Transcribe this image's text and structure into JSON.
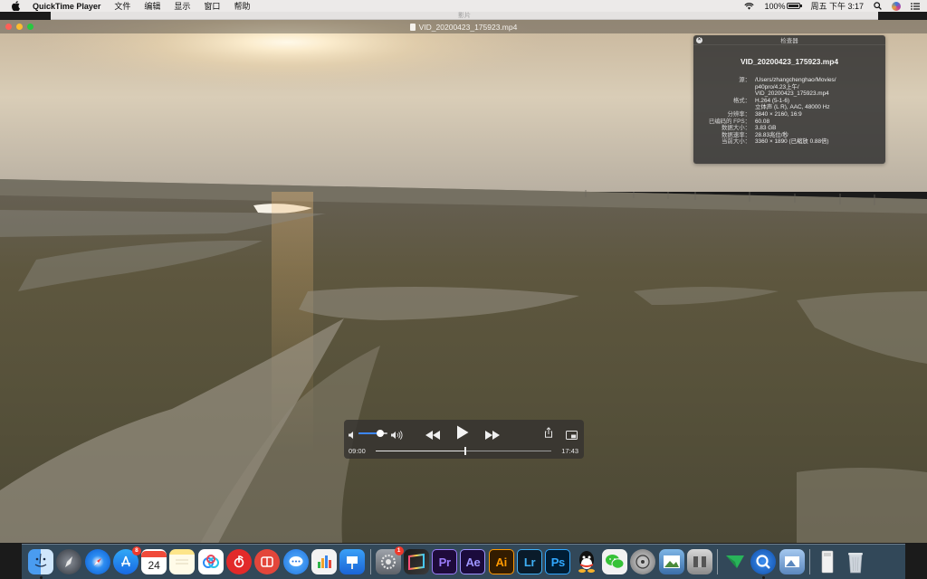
{
  "menubar": {
    "app_name": "QuickTime Player",
    "items": [
      "文件",
      "编辑",
      "显示",
      "窗口",
      "帮助"
    ],
    "battery": "100%",
    "clock": "周五 下午 3:17"
  },
  "background_window": {
    "title": "影片"
  },
  "player": {
    "title": "VID_20200423_175923.mp4",
    "current_time": "09:00",
    "end_time": "17:43",
    "progress": 0.51,
    "volume": 0.75
  },
  "inspector": {
    "title": "检查器",
    "filename": "VID_20200423_175923.mp4",
    "rows": [
      {
        "key": "源：",
        "lines": [
          "/Users/zhangchenghao/Movies/",
          "p40pro/4.23上午/",
          "VID_20200423_175923.mp4"
        ]
      },
      {
        "key": "格式：",
        "lines": [
          "H.264 (5-1-6)",
          "立体声 (L R), AAC, 48000 Hz"
        ]
      },
      {
        "key": "分辨率：",
        "lines": [
          "3840 × 2160, 16:9"
        ]
      },
      {
        "key": "已编码的 FPS：",
        "lines": [
          "60.08"
        ]
      },
      {
        "key": "数据大小：",
        "lines": [
          "3.83 GB"
        ]
      },
      {
        "key": "数据速率：",
        "lines": [
          "28.83兆位/秒"
        ]
      },
      {
        "key": "当前大小：",
        "lines": [
          "3360 × 1890 (已缩放 0.88倍)"
        ]
      }
    ]
  },
  "dock": {
    "calendar_day": "24",
    "appstore_badge": "8",
    "prefs_badge": "1",
    "adobe": [
      "Pr",
      "Ae",
      "Ai",
      "Lr",
      "Ps"
    ]
  },
  "colors": {
    "accent_blue": "#3d87ff",
    "close": "#ff5f57",
    "minimize": "#febc2e",
    "zoom": "#28c840"
  }
}
